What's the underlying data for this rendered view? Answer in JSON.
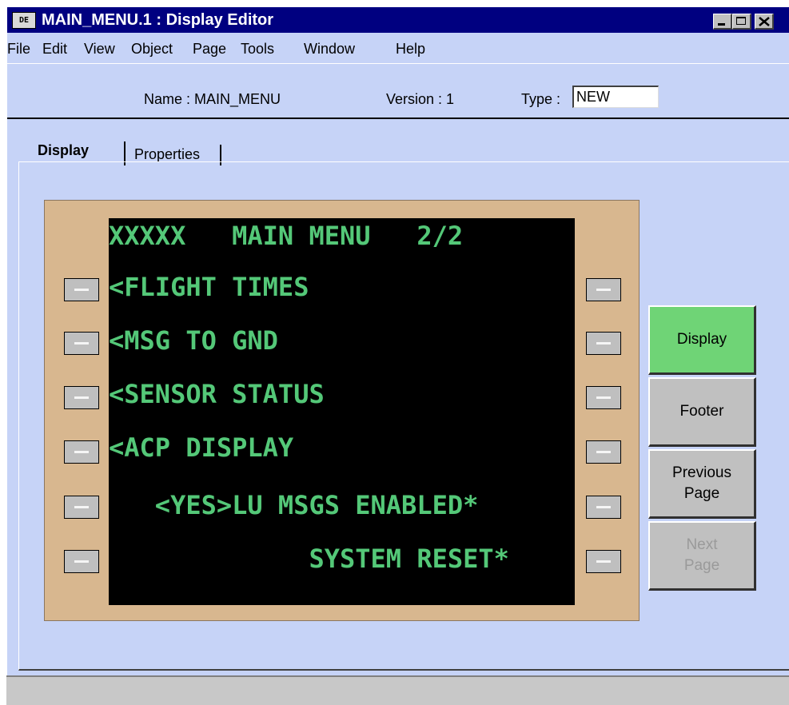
{
  "window": {
    "app_icon": "DE",
    "title": "MAIN_MENU.1 : Display Editor",
    "controls": [
      "minimize-icon",
      "maximize-icon",
      "close-icon"
    ]
  },
  "menu": [
    "File",
    "Edit",
    "View",
    "Object",
    "Page",
    "Tools",
    "Window",
    "Help"
  ],
  "info": {
    "name_label": "Name : MAIN_MENU",
    "version_label": "Version : 1",
    "type_label": "Type :",
    "type_value": "NEW"
  },
  "tabs": [
    "Display",
    "Properties"
  ],
  "screen": {
    "lines": [
      "XXXXX   MAIN MENU   2/2",
      "<FLIGHT TIMES",
      "<MSG TO GND",
      "<SENSOR STATUS",
      "<ACP DISPLAY",
      "   <YES>LU MSGS ENABLED*",
      "             SYSTEM RESET*"
    ],
    "text_color": "#54c878",
    "bezel_color": "#d8b78f"
  },
  "side_buttons": [
    "Display",
    "Footer",
    "Previous Page",
    "Next Page"
  ],
  "colors": {
    "titlebar": "#000080",
    "window_bg": "#c6d3f7",
    "active_button": "#6fd476"
  }
}
